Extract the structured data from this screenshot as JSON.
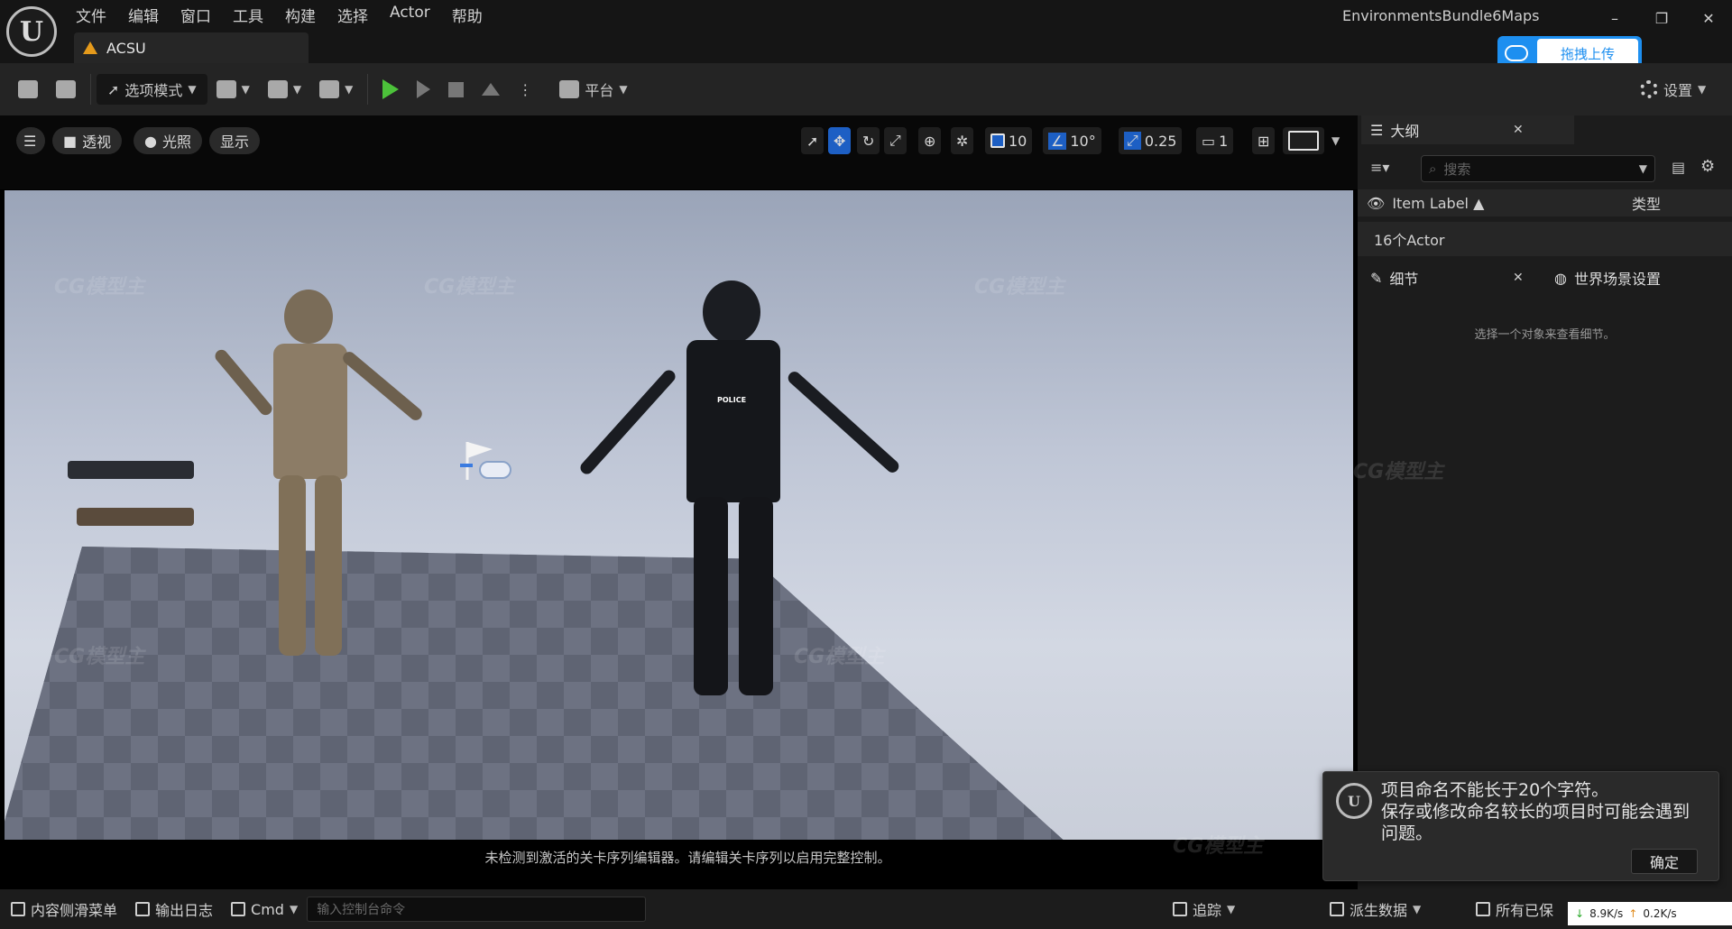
{
  "menu": [
    "文件",
    "编辑",
    "窗口",
    "工具",
    "构建",
    "选择",
    "Actor",
    "帮助"
  ],
  "level_tab": "ACSU",
  "project_title": "EnvironmentsBundle6Maps",
  "window_controls": {
    "minimize": "–",
    "restore": "❐",
    "close": "✕"
  },
  "upload_button": "拖拽上传",
  "toolbar": {
    "mode_label": "选项模式",
    "platform_label": "平台",
    "settings_label": "设置"
  },
  "viewport": {
    "perspective": "透视",
    "lighting": "光照",
    "show": "显示",
    "grid_snap": "10",
    "rot_snap": "10°",
    "scale_snap": "0.25",
    "camera_speed": "1",
    "police_label": "POLICE",
    "message": "未检测到激活的关卡序列编辑器。请编辑关卡序列以启用完整控制。"
  },
  "outliner": {
    "tab": "大纲",
    "search_placeholder": "搜索",
    "col_label": "Item Label ▲",
    "col_type": "类型",
    "actor_count": "16个Actor"
  },
  "details": {
    "tab": "细节",
    "world_settings_tab": "世界场景设置",
    "empty_hint": "选择一个对象来查看细节。"
  },
  "notification": {
    "line1": "项目命名不能长于20个字符。",
    "line2": "保存或修改命名较长的项目时可能会遇到问题。",
    "ok_label": "确定"
  },
  "statusbar": {
    "content_drawer": "内容侧滑菜单",
    "output_log": "输出日志",
    "cmd": "Cmd",
    "console_placeholder": "输入控制台命令",
    "trace": "追踪",
    "derived_data": "派生数据",
    "all_saved": "所有已保",
    "down_speed": "8.9K/s",
    "up_speed": "0.2K/s"
  },
  "watermark": "CG模型主",
  "colors": {
    "accent_blue": "#1d5fc4",
    "play_green": "#4cc23a",
    "warning_orange": "#e59a1b",
    "upload_blue": "#1d8ff0"
  }
}
